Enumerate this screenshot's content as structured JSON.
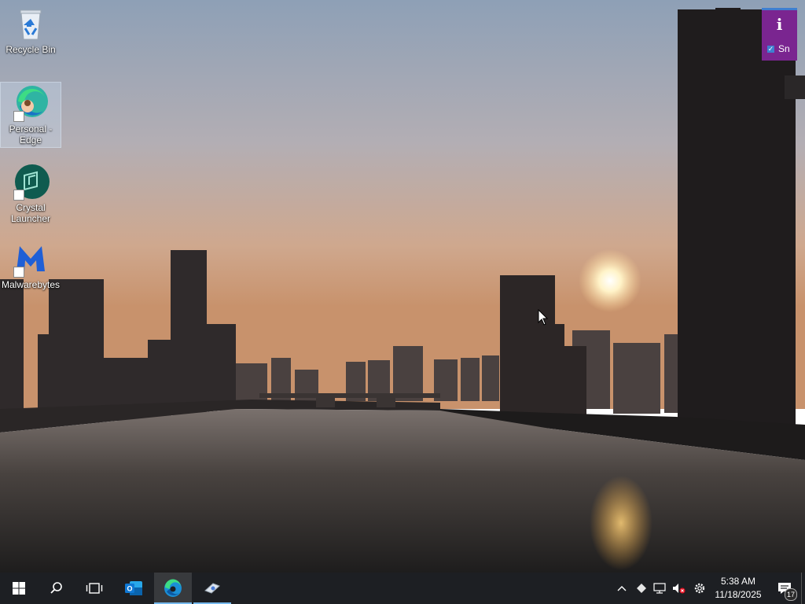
{
  "desktop": {
    "icons": [
      {
        "label": "Recycle Bin"
      },
      {
        "label": "Personal - Edge"
      },
      {
        "label": "Crystal Launcher"
      },
      {
        "label": "Malwarebytes"
      }
    ]
  },
  "notice": {
    "glyph": "i",
    "checkbox_label": "Sn"
  },
  "taskbar": {
    "apps": [
      {
        "icon": "windows-start-icon"
      },
      {
        "icon": "search-icon"
      },
      {
        "icon": "task-view-icon"
      },
      {
        "icon": "outlook-icon"
      },
      {
        "icon": "edge-icon"
      },
      {
        "icon": "app-icon"
      }
    ],
    "tray": {
      "time": "5:38 AM",
      "date": "11/18/2025",
      "notifications": "17"
    }
  },
  "colors": {
    "taskbar": "#1d1f23",
    "accent": "#76b9ed",
    "notice": "#7a2590"
  }
}
